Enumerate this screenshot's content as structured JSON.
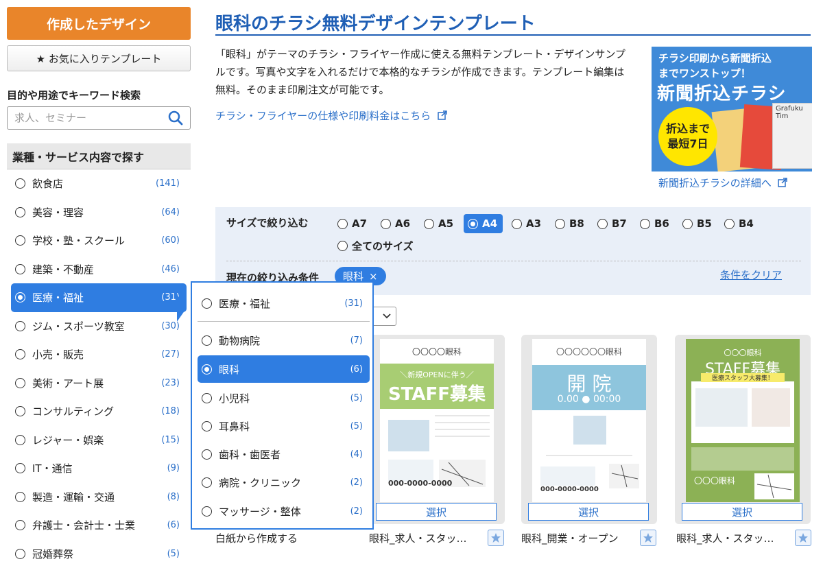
{
  "sidebar": {
    "create_button": "作成したデザイン",
    "favorites_button": "★ お気に入りテンプレート",
    "keyword_title": "目的や用途でキーワード検索",
    "search_placeholder": "求人、セミナー",
    "category_heading": "業種・サービス内容で探す",
    "categories": [
      {
        "label": "飲食店",
        "count": "(141)"
      },
      {
        "label": "美容・理容",
        "count": "(64)"
      },
      {
        "label": "学校・塾・スクール",
        "count": "(60)"
      },
      {
        "label": "建築・不動産",
        "count": "(46)"
      },
      {
        "label": "医療・福祉",
        "count": "(31)"
      },
      {
        "label": "ジム・スポーツ教室",
        "count": "(30)"
      },
      {
        "label": "小売・販売",
        "count": "(27)"
      },
      {
        "label": "美術・アート展",
        "count": "(23)"
      },
      {
        "label": "コンサルティング",
        "count": "(18)"
      },
      {
        "label": "レジャー・娯楽",
        "count": "(15)"
      },
      {
        "label": "IT・通信",
        "count": "(9)"
      },
      {
        "label": "製造・運輸・交通",
        "count": "(8)"
      },
      {
        "label": "弁護士・会計士・士業",
        "count": "(6)"
      },
      {
        "label": "冠婚葬祭",
        "count": "(5)"
      }
    ]
  },
  "dropdown": {
    "parent": {
      "label": "医療・福祉",
      "count": "(31)"
    },
    "items": [
      {
        "label": "動物病院",
        "count": "(7)"
      },
      {
        "label": "眼科",
        "count": "(6)"
      },
      {
        "label": "小児科",
        "count": "(5)"
      },
      {
        "label": "耳鼻科",
        "count": "(5)"
      },
      {
        "label": "歯科・歯医者",
        "count": "(4)"
      },
      {
        "label": "病院・クリニック",
        "count": "(2)"
      },
      {
        "label": "マッサージ・整体",
        "count": "(2)"
      }
    ]
  },
  "main": {
    "title": "眼科のチラシ無料デザインテンプレート",
    "description": "「眼科」がテーマのチラシ・フライヤー作成に使える無料テンプレート・デザインサンプルです。写真や文字を入れるだけで本格的なチラシが作成できます。テンプレート編集は無料。そのまま印刷注文が可能です。",
    "spec_link": "チラシ・フライヤーの仕様や印刷料金はこちら",
    "banner": {
      "line1": "チラシ印刷から新聞折込",
      "line2": "までワンストップ！",
      "big": "新聞折込チラシ",
      "bubble1": "折込まで",
      "bubble2": "最短7日",
      "paper_text": "Grafuku Tim"
    },
    "banner_link": "新聞折込チラシの詳細へ",
    "filter": {
      "size_label": "サイズで絞り込む",
      "sizes": [
        "A7",
        "A6",
        "A5",
        "A4",
        "A3",
        "B8",
        "B7",
        "B6",
        "B5",
        "B4",
        "全てのサイズ"
      ],
      "current_label": "現在の絞り込み条件",
      "chip": "眼科",
      "chip_close": "×",
      "clear": "条件をクリア"
    },
    "blank_label": "白紙から作成する",
    "select_label": "選択",
    "cards": [
      {
        "name": "眼科_求人・スタッ…",
        "clinic": "〇〇〇〇眼科",
        "banner": "＼新規OPENに伴う／",
        "headline": "STAFF募集",
        "phone": "000-0000-0000"
      },
      {
        "name": "眼科_開業・オープン",
        "clinic": "〇〇〇〇〇〇眼科",
        "headline": "開 院",
        "date": "0.00 ● 00:00",
        "phone": "000-0000-0000"
      },
      {
        "name": "眼科_求人・スタッ…",
        "clinic": "〇〇〇眼科",
        "headline": "STAFF募集",
        "sub": "医療スタッフ大募集！",
        "footer": "〇〇〇眼科"
      }
    ]
  },
  "colors": {
    "accent": "#2f7de1",
    "orange": "#e9852a",
    "title": "#1f5fb5",
    "filter_bg": "#e9eff8"
  }
}
